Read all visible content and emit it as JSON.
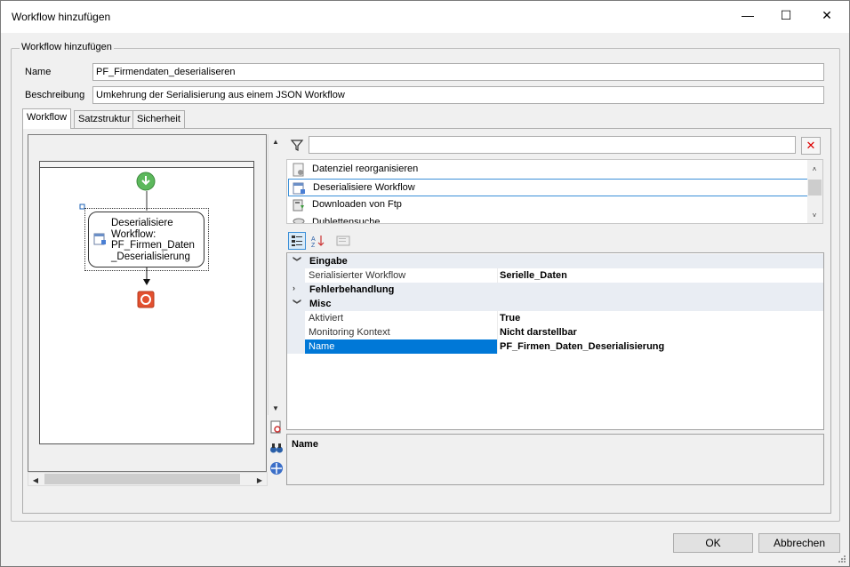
{
  "window": {
    "title": "Workflow hinzufügen",
    "controls": {
      "minimize": "—",
      "maximize": "☐",
      "close": "✕"
    }
  },
  "group": {
    "caption": "Workflow hinzufügen"
  },
  "form": {
    "name_label": "Name",
    "name_value": "PF_Firmendaten_deserialiseren",
    "desc_label": "Beschreibung",
    "desc_value": "Umkehrung der Serialisierung aus einem JSON Workflow"
  },
  "tabs": [
    {
      "label": "Workflow",
      "active": true
    },
    {
      "label": "Satzstruktur",
      "active": false
    },
    {
      "label": "Sicherheit",
      "active": false
    }
  ],
  "designer": {
    "node_text": "Deserialisiere\nWorkflow:\nPF_Firmen_Daten\n_Deserialisierung",
    "colors": {
      "start": "#5cb85c",
      "stop": "#e2502f"
    }
  },
  "filter": {
    "value": "",
    "icon": "filter-icon",
    "clear_icon": "clear-filter-icon"
  },
  "activities": [
    {
      "label": "Datenziel reorganisieren",
      "icon": "reorganize-icon",
      "selected": false
    },
    {
      "label": "Deserialisiere Workflow",
      "icon": "deserialize-icon",
      "selected": true
    },
    {
      "label": "Downloaden von Ftp",
      "icon": "ftp-download-icon",
      "selected": false
    },
    {
      "label": "Dublettensuche",
      "icon": "duplicate-search-icon",
      "selected": false
    }
  ],
  "propertygrid": {
    "categories": [
      {
        "name": "Eingabe",
        "expanded": true,
        "props": [
          {
            "name": "Serialisierter Workflow",
            "value": "Serielle_Daten",
            "selected": false
          }
        ]
      },
      {
        "name": "Fehlerbehandlung",
        "expanded": false,
        "props": []
      },
      {
        "name": "Misc",
        "expanded": true,
        "props": [
          {
            "name": "Aktiviert",
            "value": "True",
            "selected": false
          },
          {
            "name": "Monitoring Kontext",
            "value": "Nicht darstellbar",
            "selected": false
          },
          {
            "name": "Name",
            "value": "PF_Firmen_Daten_Deserialisierung",
            "selected": true
          }
        ]
      }
    ],
    "description_title": "Name"
  },
  "buttons": {
    "ok": "OK",
    "cancel": "Abbrechen"
  },
  "accent": "#0078d7"
}
